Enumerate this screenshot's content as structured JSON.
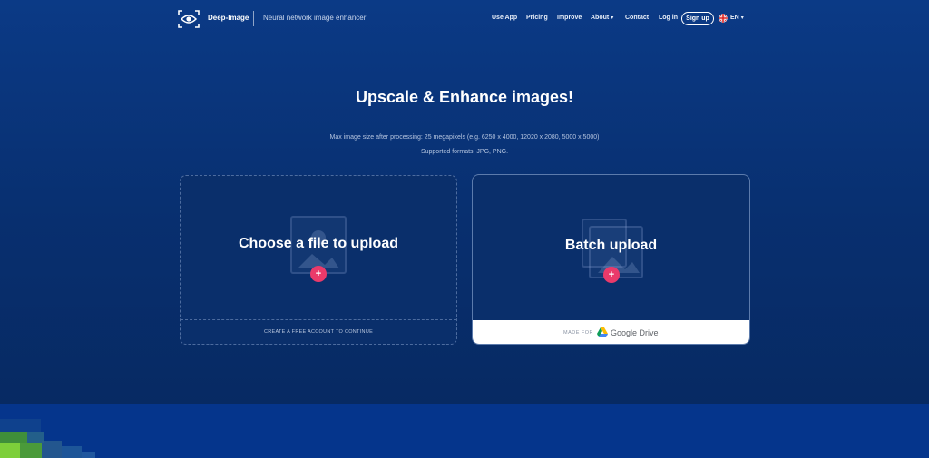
{
  "header": {
    "brand": "Deep-Image",
    "tagline": "Neural network image enhancer",
    "nav": {
      "use_app": "Use App",
      "pricing": "Pricing",
      "improve": "Improve",
      "about": "About",
      "contact": "Contact",
      "login": "Log in"
    },
    "signup": "Sign up",
    "lang": "EN"
  },
  "hero": {
    "title": "Upscale & Enhance images!",
    "max_size": "Max image size after processing: 25 megapixels (e.g. 6250 x 4000, 12020 x 2080, 5000 x 5000)",
    "formats": "Supported formats: JPG, PNG."
  },
  "upload_card": {
    "heading": "Choose a file to upload",
    "footer": "CREATE A FREE ACCOUNT TO CONTINUE"
  },
  "batch_card": {
    "heading": "Batch upload",
    "made_for": "MADE FOR",
    "drive_label": "Google Drive"
  },
  "colors": {
    "accent_plus": "#ea3a6a",
    "background": "#0b3a86"
  },
  "icons": [
    "logo-eye-icon",
    "chevron-down-icon",
    "uk-flag-icon",
    "image-placeholder-icon",
    "plus-icon",
    "google-drive-icon"
  ]
}
